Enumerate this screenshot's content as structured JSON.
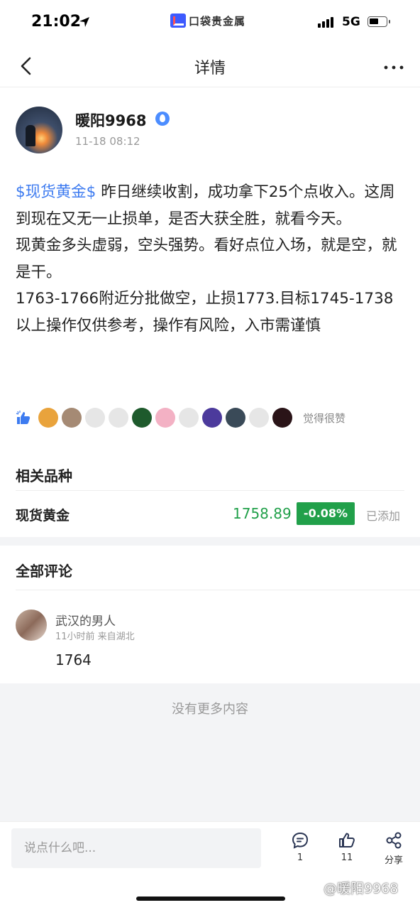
{
  "status_bar": {
    "time": "21:02",
    "app_name": "口袋贵金属",
    "network": "5G"
  },
  "nav": {
    "title": "详情"
  },
  "post": {
    "author": "暖阳9968",
    "time": "11-18 08:12",
    "tag": "$现货黄金$",
    "line1_rest": " 昨日继续收割，成功拿下25个点收入。这周到现在又无一止损单，是否大获全胜，就看今天。",
    "line2": "现黄金多头虚弱，空头强势。看好点位入场，就是空，就是干。",
    "line3": "1763-1766附近分批做空，止损1773.目标1745-1738",
    "line4": "以上操作仅供参考，操作有风险，入市需谨慎"
  },
  "likes": {
    "text": "觉得很赞",
    "avatar_colors": [
      "#e9a33c",
      "#a58a74",
      "#e6e6e6",
      "#e6e6e6",
      "#1e5a2c",
      "#f3b1c4",
      "#e6e6e6",
      "#4c3a9c",
      "#3a4a58",
      "#e6e6e6",
      "#2a1418"
    ]
  },
  "related": {
    "title": "相关品种",
    "product": {
      "name": "现货黄金",
      "price": "1758.89",
      "change": "-0.08%",
      "status": "已添加"
    }
  },
  "comments": {
    "title": "全部评论",
    "items": [
      {
        "user": "武汉的男人",
        "meta": "11小时前  来自湖北",
        "text": "1764"
      }
    ],
    "no_more": "没有更多内容"
  },
  "bottom_bar": {
    "input_placeholder": "说点什么吧...",
    "comment_count": "1",
    "like_count": "11",
    "share_label": "分享"
  },
  "watermark": "@暖阳9968",
  "colors": {
    "link": "#3d7bf0",
    "down_green": "#21a04a",
    "muted": "#999999"
  }
}
